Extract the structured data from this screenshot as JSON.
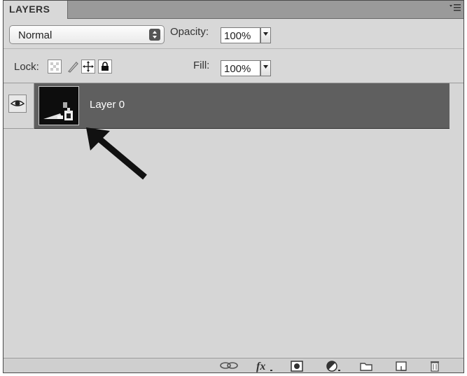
{
  "panel": {
    "tab_label": "LAYERS",
    "menu_icon": "panel-menu-icon"
  },
  "blend": {
    "mode": "Normal",
    "opacity_label": "Opacity:",
    "opacity_value": "100%"
  },
  "lock": {
    "label": "Lock:",
    "icons": [
      "lock-transparent-pixels-icon",
      "lock-image-pixels-icon",
      "lock-position-icon",
      "lock-all-icon"
    ],
    "fill_label": "Fill:",
    "fill_value": "100%"
  },
  "layers": [
    {
      "name": "Layer 0",
      "visible": true,
      "selected": true
    }
  ],
  "bottom_icons": [
    "link-layers-icon",
    "fx-icon",
    "layer-mask-icon",
    "adjustment-layer-icon",
    "group-folder-icon",
    "new-layer-icon",
    "trash-icon"
  ],
  "colors": {
    "panel_bg": "#d8d8d8",
    "selected_row": "#5f5f5f",
    "tabbar": "#9a9a9a"
  }
}
